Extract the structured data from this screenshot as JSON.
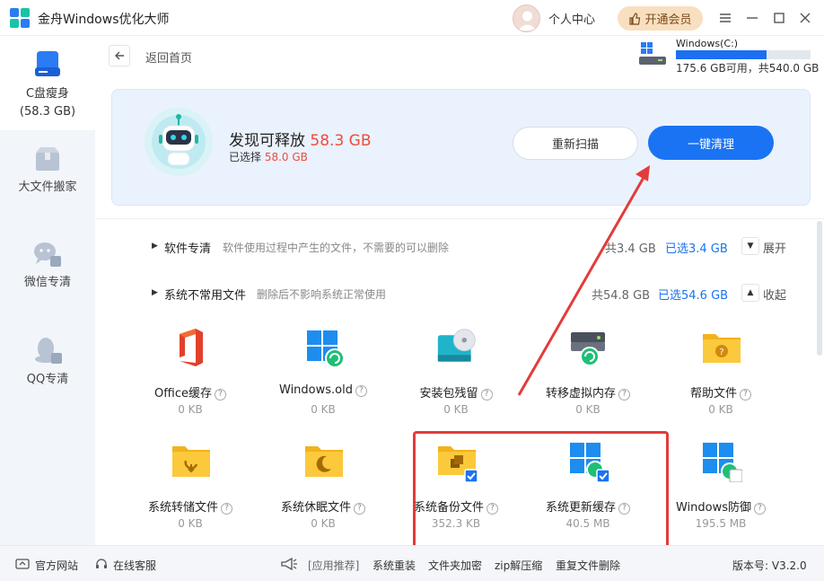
{
  "app": {
    "title": "金舟Windows优化大师"
  },
  "header": {
    "user_center": "个人中心",
    "vip_button": "开通会员"
  },
  "sidebar": {
    "items": [
      {
        "label": "C盘瘦身",
        "sub": "(58.3 GB)"
      },
      {
        "label": "大文件搬家"
      },
      {
        "label": "微信专清"
      },
      {
        "label": "QQ专清"
      }
    ]
  },
  "topbar": {
    "back_label": "返回首页",
    "disk": {
      "name": "Windows(C:)",
      "usage": "175.6 GB可用，共540.0 GB",
      "used_fraction": 0.675
    }
  },
  "found": {
    "title_prefix": "发现可释放",
    "title_size": "58.3 GB",
    "selected_prefix": "已选择",
    "selected_size": "58.0 GB",
    "rescan_button": "重新扫描",
    "clean_button": "一键清理"
  },
  "sections": [
    {
      "title": "软件专清",
      "desc": "软件使用过程中产生的文件，不需要的可以删除",
      "total": "共3.4 GB",
      "selected": "已选3.4 GB",
      "toggle": "展开"
    },
    {
      "title": "系统不常用文件",
      "desc": "删除后不影响系统正常使用",
      "total": "共54.8 GB",
      "selected": "已选54.6 GB",
      "toggle": "收起"
    }
  ],
  "tiles": [
    {
      "name": "Office缓存",
      "size": "0 KB"
    },
    {
      "name": "Windows.old",
      "size": "0 KB"
    },
    {
      "name": "安装包残留",
      "size": "0 KB"
    },
    {
      "name": "转移虚拟内存",
      "size": "0 KB"
    },
    {
      "name": "帮助文件",
      "size": "0 KB"
    },
    {
      "name": "系统转储文件",
      "size": "0 KB"
    },
    {
      "name": "系统休眠文件",
      "size": "0 KB"
    },
    {
      "name": "系统备份文件",
      "size": "352.3 KB"
    },
    {
      "name": "系统更新缓存",
      "size": "40.5 MB"
    },
    {
      "name": "Windows防御",
      "size": "195.5 MB"
    }
  ],
  "footer": {
    "official_site": "官方网站",
    "online_service": "在线客服",
    "app_recommend": "[应用推荐]",
    "links": [
      "系统重装",
      "文件夹加密",
      "zip解压缩",
      "重复文件删除"
    ],
    "version": "版本号: V3.2.0"
  },
  "colors": {
    "accent": "#1a73f2",
    "red": "#f04a3d",
    "vip_bg": "#f8dfbf"
  }
}
